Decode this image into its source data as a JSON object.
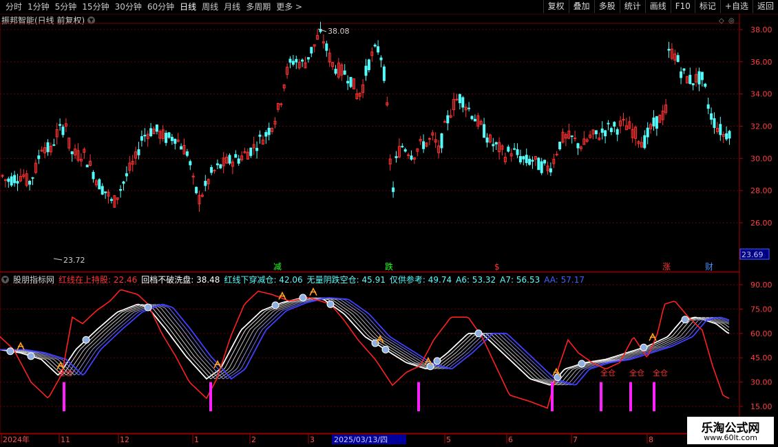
{
  "toolbar": {
    "periods": [
      "分时",
      "1分钟",
      "5分钟",
      "15分钟",
      "30分钟",
      "60分钟",
      "日线",
      "周线",
      "月线",
      "多周期",
      "更多 >"
    ],
    "active": "日线",
    "buttons": [
      "复权",
      "叠加",
      "多股",
      "统计",
      "画线",
      "F10",
      "标记",
      "+自选",
      "返回"
    ]
  },
  "price_pane": {
    "title": "振邦智能(日线 前复权)",
    "y_ticks": [
      "38.00",
      "36.00",
      "34.00",
      "32.00",
      "30.00",
      "28.00",
      "26.00"
    ],
    "high_label": "38.08",
    "low_label": "23.72",
    "current_price": "23.69",
    "markers": [
      {
        "text": "减",
        "color": "#20ff20"
      },
      {
        "text": "跌",
        "color": "#20ff20"
      },
      {
        "text": "$",
        "color": "#ff3030"
      },
      {
        "text": "涨",
        "color": "#ff3030"
      },
      {
        "text": "财",
        "color": "#4090ff"
      }
    ],
    "colors": {
      "up": "#ff3232",
      "down": "#54fcfc"
    }
  },
  "indicator_pane": {
    "name": "股朋指标网",
    "legend": [
      {
        "label": "红线在上持股:",
        "value": "22.46",
        "color": "#ff3232"
      },
      {
        "label": "回档不破洗盘:",
        "value": "38.48",
        "color": "#ffffff"
      },
      {
        "label": "红线下穿减仓:",
        "value": "42.06",
        "color": "#54fcfc"
      },
      {
        "label": "无量阴跌空仓:",
        "value": "45.91",
        "color": "#54fcfc"
      },
      {
        "label": "仅供参考:",
        "value": "49.74",
        "color": "#54fcfc"
      },
      {
        "label": "A6:",
        "value": "53.32",
        "color": "#54fcfc"
      },
      {
        "label": "A7:",
        "value": "56.53",
        "color": "#54fcfc"
      },
      {
        "label": "AA:",
        "value": "57.17",
        "color": "#4060ff"
      }
    ],
    "y_ticks": [
      "90.00",
      "75.00",
      "60.00",
      "45.00",
      "30.00",
      "15.00"
    ],
    "signal_label": "全仓"
  },
  "x_axis": {
    "labels": [
      "2024年",
      "11",
      "12",
      "1",
      "2",
      "3",
      "4",
      "5",
      "6",
      "7",
      "8"
    ],
    "cursor_date": "2025/03/13/四"
  },
  "watermark": {
    "title": "乐淘公式网",
    "url": "www.60lt.com"
  }
}
